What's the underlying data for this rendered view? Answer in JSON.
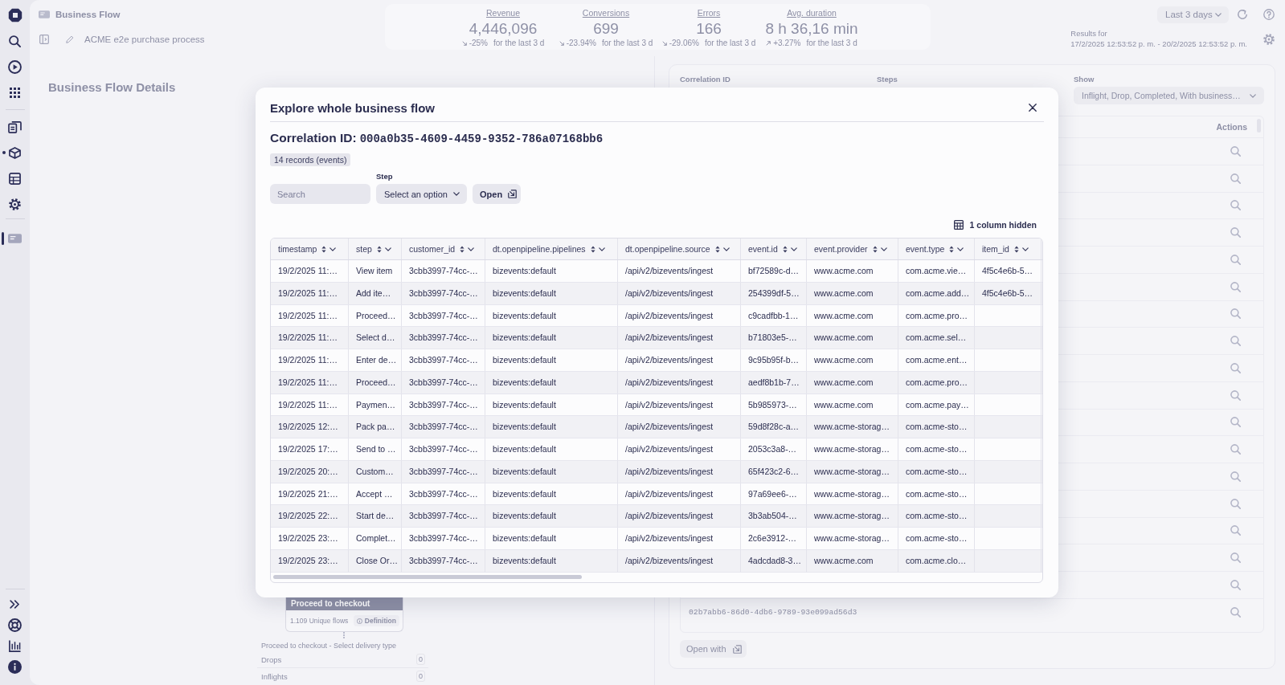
{
  "sidebar": {
    "items": [
      {
        "selected": false,
        "indicator": false
      },
      {
        "selected": false,
        "indicator": false
      },
      {
        "selected": false,
        "indicator": false
      },
      {
        "selected": false,
        "indicator": false
      },
      {
        "selected": false,
        "indicator": true
      },
      {
        "selected": false,
        "indicator": false
      },
      {
        "selected": false,
        "indicator": false
      },
      {
        "selected": true,
        "indicator": false
      }
    ]
  },
  "header": {
    "app_title": "Business Flow",
    "flow_name": "ACME e2e purchase process"
  },
  "kpis": [
    {
      "label": "Revenue",
      "value": "4,446,096",
      "up": false,
      "change": "-25%",
      "period": "for the last 3 d"
    },
    {
      "label": "Conversions",
      "value": "699",
      "up": false,
      "change": "-23.94%",
      "period": "for the last 3 d"
    },
    {
      "label": "Errors",
      "value": "166",
      "up": false,
      "change": "-29.06%",
      "period": "for the last 3 d"
    },
    {
      "label": "Avg. duration",
      "value": "8 h 36,16 min",
      "up": true,
      "change": "+3.27%",
      "period": "for the last 3 d"
    }
  ],
  "timeframe": {
    "value": "Last 3 days",
    "results_label": "Results for",
    "results_range": "17/2/2025 12:53:52 p. m. - 20/2/2025 12:53:52 p. m."
  },
  "details": {
    "title": "Business Flow Details",
    "node": {
      "title": "Proceed to checkout",
      "flows": "1.109 Unique flows",
      "definition": "Definition"
    },
    "transition": {
      "title": "Proceed to checkout - Select delivery type",
      "stats": [
        {
          "label": "Drops",
          "value": "0"
        },
        {
          "label": "Inflights",
          "value": "0"
        }
      ]
    }
  },
  "flows": {
    "filters": [
      {
        "label": "Correlation ID"
      },
      {
        "label": "Steps"
      },
      {
        "label": "Show",
        "value": "Inflight, Drop, Completed, With business…"
      }
    ],
    "actions_header": "Actions",
    "rows": [
      {},
      {},
      {},
      {},
      {},
      {},
      {},
      {},
      {},
      {},
      {},
      {},
      {},
      {},
      {},
      {},
      {},
      {
        "correlation_id": "02b7abb6-86d0-4db6-9789-93e099ad56d3"
      }
    ],
    "open_with": "Open with"
  },
  "modal": {
    "title": "Explore whole business flow",
    "correlation_label": "Correlation ID:",
    "correlation_id": "000a0b35-4609-4459-9352-786a07168bb6",
    "records": "14 records (events)",
    "search": {
      "placeholder": "Search"
    },
    "step": {
      "label": "Step",
      "placeholder": "Select an option"
    },
    "open_button": "Open",
    "hidden_columns": "1 column hidden",
    "table": {
      "columns": [
        "timestamp",
        "step",
        "customer_id",
        "dt.openpipeline.pipelines",
        "dt.openpipeline.source",
        "event.id",
        "event.provider",
        "event.type",
        "item_id"
      ],
      "rows": [
        {
          "cells": [
            "19/2/2025 11:…",
            "View item",
            "3cbb3997-74cc-…",
            "bizevents:default",
            "/api/v2/bizevents/ingest",
            "bf72589c-d…",
            "www.acme.com",
            "com.acme.vie…",
            "4f5c4e6b-5…"
          ]
        },
        {
          "cells": [
            "19/2/2025 11:…",
            "Add ite…",
            "3cbb3997-74cc-…",
            "bizevents:default",
            "/api/v2/bizevents/ingest",
            "254399df-5…",
            "www.acme.com",
            "com.acme.add…",
            "4f5c4e6b-5…"
          ]
        },
        {
          "cells": [
            "19/2/2025 11:…",
            "Proceed…",
            "3cbb3997-74cc-…",
            "bizevents:default",
            "/api/v2/bizevents/ingest",
            "c9cadfbb-1…",
            "www.acme.com",
            "com.acme.pro…"
          ]
        },
        {
          "cells": [
            "19/2/2025 11:…",
            "Select d…",
            "3cbb3997-74cc-…",
            "bizevents:default",
            "/api/v2/bizevents/ingest",
            "b71803e5-…",
            "www.acme.com",
            "com.acme.sel…"
          ]
        },
        {
          "cells": [
            "19/2/2025 11:…",
            "Enter de…",
            "3cbb3997-74cc-…",
            "bizevents:default",
            "/api/v2/bizevents/ingest",
            "9c95b95f-b…",
            "www.acme.com",
            "com.acme.ent…"
          ]
        },
        {
          "cells": [
            "19/2/2025 11:…",
            "Proceed…",
            "3cbb3997-74cc-…",
            "bizevents:default",
            "/api/v2/bizevents/ingest",
            "aedf8b1b-7…",
            "www.acme.com",
            "com.acme.pro…"
          ]
        },
        {
          "cells": [
            "19/2/2025 11:…",
            "Paymen…",
            "3cbb3997-74cc-…",
            "bizevents:default",
            "/api/v2/bizevents/ingest",
            "5b985973-…",
            "www.acme.com",
            "com.acme.pay…"
          ]
        },
        {
          "cells": [
            "19/2/2025 12:…",
            "Pack pa…",
            "3cbb3997-74cc-…",
            "bizevents:default",
            "/api/v2/bizevents/ingest",
            "59d8f28c-a…",
            "www.acme-storag…",
            "com.acme-sto…"
          ]
        },
        {
          "cells": [
            "19/2/2025 17:…",
            "Send to …",
            "3cbb3997-74cc-…",
            "bizevents:default",
            "/api/v2/bizevents/ingest",
            "2053c3a8-…",
            "www.acme-storag…",
            "com.acme-sto…"
          ]
        },
        {
          "cells": [
            "19/2/2025 20:…",
            "Custom…",
            "3cbb3997-74cc-…",
            "bizevents:default",
            "/api/v2/bizevents/ingest",
            "65f423c2-6…",
            "www.acme-storag…",
            "com.acme-sto…"
          ]
        },
        {
          "cells": [
            "19/2/2025 21:…",
            "Accept …",
            "3cbb3997-74cc-…",
            "bizevents:default",
            "/api/v2/bizevents/ingest",
            "97a69ee6-…",
            "www.acme-storag…",
            "com.acme-sto…"
          ]
        },
        {
          "cells": [
            "19/2/2025 22:…",
            "Start de…",
            "3cbb3997-74cc-…",
            "bizevents:default",
            "/api/v2/bizevents/ingest",
            "3b3ab504-…",
            "www.acme-storag…",
            "com.acme-sto…"
          ]
        },
        {
          "cells": [
            "19/2/2025 23:…",
            "Complet…",
            "3cbb3997-74cc-…",
            "bizevents:default",
            "/api/v2/bizevents/ingest",
            "2c6e3912-…",
            "www.acme-storag…",
            "com.acme-sto…"
          ]
        },
        {
          "cells": [
            "19/2/2025 23:…",
            "Close Or…",
            "3cbb3997-74cc-…",
            "bizevents:default",
            "/api/v2/bizevents/ingest",
            "4adcdad8-3…",
            "www.acme.com",
            "com.acme.clo…"
          ]
        }
      ]
    }
  }
}
